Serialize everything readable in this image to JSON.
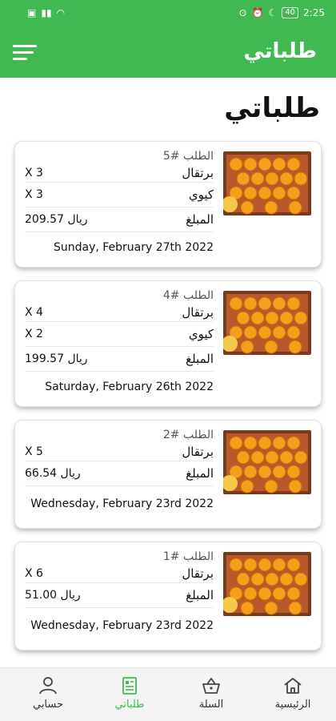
{
  "status_bar": {
    "time": "2:25",
    "battery": "40"
  },
  "app_bar": {
    "title": "طلباتي"
  },
  "page": {
    "title": "طلباتي"
  },
  "labels": {
    "amount_label": "المبلغ"
  },
  "orders": [
    {
      "order_no": "الطلب #5",
      "items": [
        {
          "name": "برتقال",
          "qty": "X 3"
        },
        {
          "name": "كيوي",
          "qty": "X 3"
        }
      ],
      "amount": "209.57 ريال",
      "date": "Sunday, February 27th 2022"
    },
    {
      "order_no": "الطلب #4",
      "items": [
        {
          "name": "برتقال",
          "qty": "X 4"
        },
        {
          "name": "كيوي",
          "qty": "X 2"
        }
      ],
      "amount": "199.57 ريال",
      "date": "Saturday, February 26th 2022"
    },
    {
      "order_no": "الطلب #2",
      "items": [
        {
          "name": "برتقال",
          "qty": "X 5"
        }
      ],
      "amount": "66.54 ريال",
      "date": "Wednesday, February 23rd 2022"
    },
    {
      "order_no": "الطلب #1",
      "items": [
        {
          "name": "برتقال",
          "qty": "X 6"
        }
      ],
      "amount": "51.00 ريال",
      "date": "Wednesday, February 23rd 2022"
    }
  ],
  "bottom_nav": [
    {
      "label": "الرئيسية",
      "icon": "home-icon"
    },
    {
      "label": "السلة",
      "icon": "basket-icon"
    },
    {
      "label": "طلباتي",
      "icon": "orders-icon",
      "active": true
    },
    {
      "label": "حسابي",
      "icon": "user-icon"
    }
  ],
  "colors": {
    "primary": "#3fb950",
    "active": "#3fb950"
  }
}
